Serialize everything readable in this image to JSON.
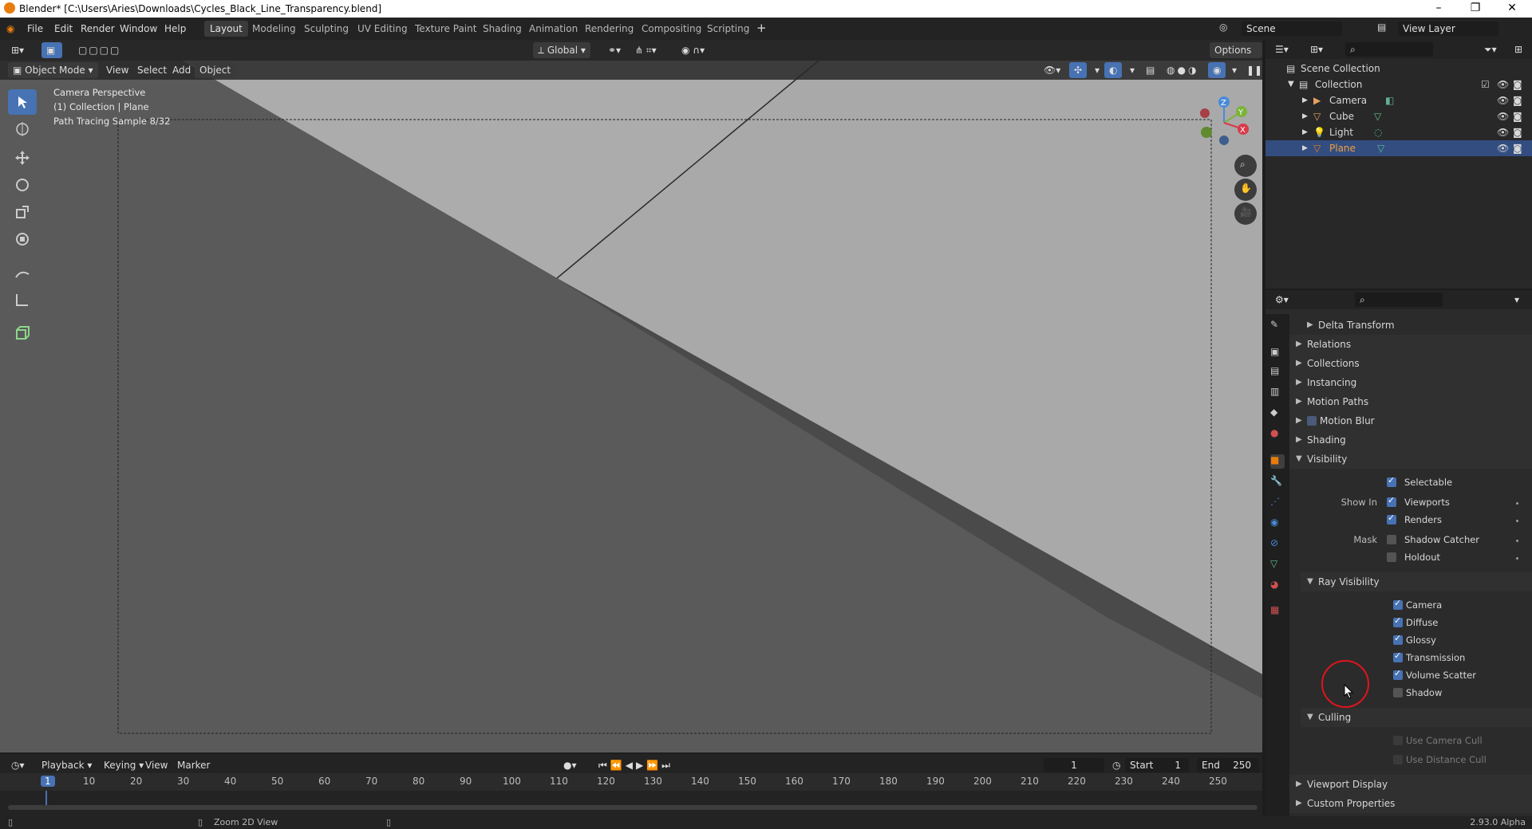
{
  "window": {
    "title": "Blender* [C:\\Users\\Aries\\Downloads\\Cycles_Black_Line_Transparency.blend]"
  },
  "menu": [
    "File",
    "Edit",
    "Render",
    "Window",
    "Help"
  ],
  "workspaces": [
    "Layout",
    "Modeling",
    "Sculpting",
    "UV Editing",
    "Texture Paint",
    "Shading",
    "Animation",
    "Rendering",
    "Compositing",
    "Scripting"
  ],
  "scene": {
    "name": "Scene",
    "view_layer": "View Layer"
  },
  "viewport": {
    "mode": "Object Mode",
    "menus": [
      "View",
      "Select",
      "Add",
      "Object"
    ],
    "orientation": "Global",
    "options_label": "Options",
    "overlay_lines": [
      "Camera Perspective",
      "(1) Collection | Plane",
      "Path Tracing Sample 8/32"
    ]
  },
  "gizmo": {
    "z": "Z",
    "y": "Y",
    "x": "X"
  },
  "timeline": {
    "menus": [
      "Playback",
      "Keying",
      "View",
      "Marker"
    ],
    "current_frame": "1",
    "start_label": "Start",
    "start_value": "1",
    "end_label": "End",
    "end_value": "250",
    "ticks": [
      "1",
      "10",
      "20",
      "30",
      "40",
      "50",
      "60",
      "70",
      "80",
      "90",
      "100",
      "110",
      "120",
      "130",
      "140",
      "150",
      "160",
      "170",
      "180",
      "190",
      "200",
      "210",
      "220",
      "230",
      "240",
      "250"
    ]
  },
  "status": {
    "hint": "Zoom 2D View",
    "version": "2.93.0 Alpha"
  },
  "outliner": {
    "root": "Scene Collection",
    "collection": "Collection",
    "items": [
      "Camera",
      "Cube",
      "Light",
      "Plane"
    ],
    "selected": "Plane"
  },
  "properties": {
    "panels_top": [
      "Delta Transform",
      "Relations",
      "Collections",
      "Instancing",
      "Motion Paths",
      "Motion Blur",
      "Shading",
      "Visibility"
    ],
    "visibility": {
      "selectable": "Selectable",
      "show_in_label": "Show In",
      "viewports": "Viewports",
      "renders": "Renders",
      "mask_label": "Mask",
      "shadow_catcher": "Shadow Catcher",
      "holdout": "Holdout"
    },
    "ray_visibility": {
      "header": "Ray Visibility",
      "items": [
        "Camera",
        "Diffuse",
        "Glossy",
        "Transmission",
        "Volume Scatter",
        "Shadow"
      ],
      "checked": [
        true,
        true,
        true,
        true,
        true,
        false
      ]
    },
    "culling": {
      "header": "Culling",
      "items": [
        "Use Camera Cull",
        "Use Distance Cull"
      ]
    },
    "panels_bottom": [
      "Viewport Display",
      "Custom Properties"
    ]
  },
  "colors": {
    "accent": "#4772b3",
    "selected_row": "#334d80",
    "object_orange": "#e87d0d",
    "cursor_circle": "#e0141e"
  }
}
